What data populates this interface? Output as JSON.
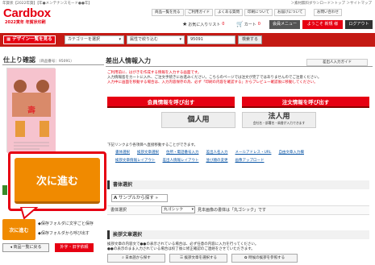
{
  "topbar": {
    "left": "年賀状【2022年賀】【年●メンテナンスモード●●年】",
    "right": "＞素材無料ダウンロード＞トップ ＞サイトマップ"
  },
  "logo": {
    "text": "Cardbox",
    "sub": "2022寅年 年賀状印刷"
  },
  "header_links": [
    "商品一覧を見る",
    "ご利用ガイド",
    "よくある質問",
    "印刷について",
    "お届けについて",
    "お問い合わせ"
  ],
  "header_icons": {
    "favorites": "お気に入りリスト",
    "favorites_count": "0",
    "cart": "カート",
    "cart_count": "0"
  },
  "header_buttons": {
    "member": "会員メニュー",
    "welcome": "ようこそ 新規 様",
    "logout": "ログアウト"
  },
  "navbar": {
    "design_btn": "デザイン一覧を見る",
    "category_placeholder": "カテゴリーを選択",
    "keyword_placeholder": "属性で絞り込む",
    "code_value": "95091",
    "search_btn": "検索する"
  },
  "left": {
    "title": "仕上り確認",
    "code": "（商品番号：95091）",
    "big_next": "次に進む",
    "small_next": "次に進む",
    "bullet1": "保存フォルダに文字ごと保存",
    "bullet2": "保存フォルダから呼び出す",
    "back_btn": "商品一覧に戻る",
    "ext_btn": "外字・旧字依頼"
  },
  "main": {
    "title": "差出人情報入力",
    "manual_btn": "差出人入力ガイド",
    "notice_red": "ご利用前に、はがきを作成する情報を入力する画面です。",
    "notice_lines": [
      "入力情報島をカートに入れ、ご注文手続きにお進みください。こちらのページでは注文が完了ではありませんのでご注意ください。",
      "入力中に画面を移動する場合は、入力内容保存の為、必ず「印刷の内容を確認する」からプレビュー確認後に移動してください。"
    ],
    "btn_member": "会員情報を呼び出す",
    "btn_order": "注文情報を呼び出す",
    "btn_personal": "個人用",
    "btn_corporate": "法人用",
    "btn_corporate_sub": "会社名・部署名・肩書が入力できます",
    "link_intro": "下記リンクより各項目へ直接移動することができます。",
    "links": [
      [
        "書体選択",
        "挨拶文章選択",
        "住所・電話番号入力",
        "差出人名入力",
        "メールアドレス・URL",
        "自由文章入力欄"
      ],
      [
        "挨拶文章情報レイアウト",
        "差出人情報レイアウト",
        "並び順の変更",
        "画像アップロード"
      ]
    ],
    "font_section": "書体選択",
    "sample_btn": "サンプルから探す",
    "font_label": "書体選択",
    "font_value": "丸ゴシック",
    "font_note": "見本画像の書体は「丸ゴシック」です",
    "greet_section": "挨拶文章選択",
    "greet_text1": "挨拶文章の内容文で●●の表示されている場合は、必ず任意の内容に入力を行ってください。",
    "greet_text2": "●●の表示のまま入力されている場合は校了後に修正確認のご連絡をさせていただきます。",
    "greet_btns": [
      "日本語から探す",
      "挨拶文章を選択する",
      "時候の挨拶を参照する"
    ]
  }
}
